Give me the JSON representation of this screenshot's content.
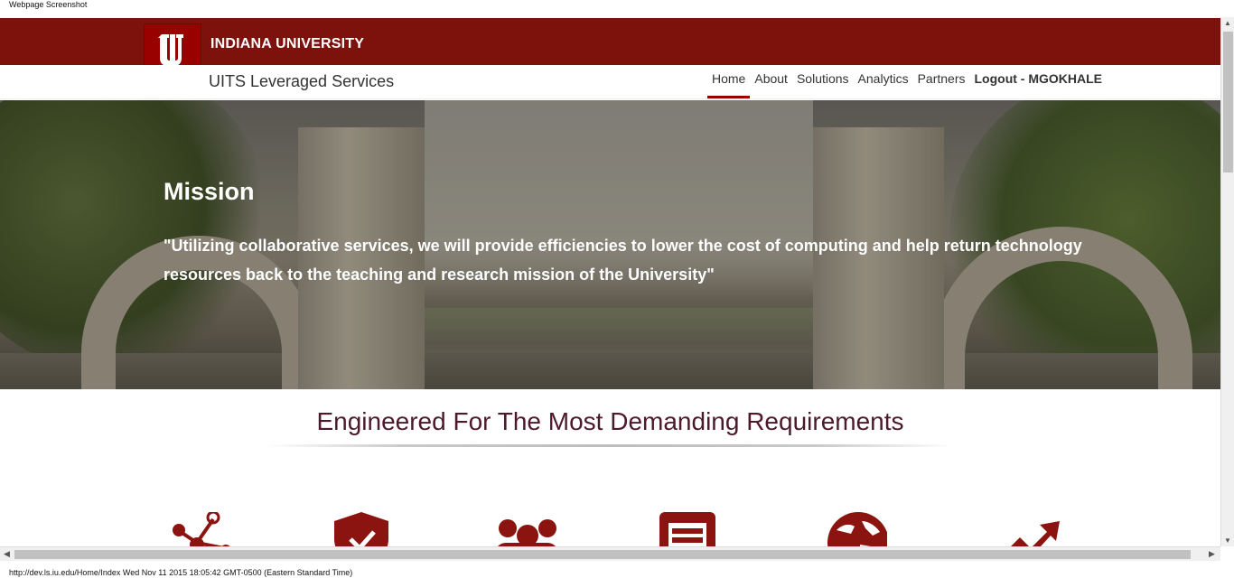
{
  "screenshot_label": "Webpage Screenshot",
  "header": {
    "university_name": "INDIANA UNIVERSITY",
    "site_title": "UITS Leveraged Services",
    "logo_icon": "iu-trident-logo",
    "brand_color": "#7d110c"
  },
  "nav": {
    "items": [
      {
        "label": "Home",
        "active": true
      },
      {
        "label": "About"
      },
      {
        "label": "Solutions"
      },
      {
        "label": "Analytics"
      },
      {
        "label": "Partners"
      },
      {
        "label": "Logout - MGOKHALE"
      }
    ]
  },
  "hero": {
    "title": "Mission",
    "quote": "\"Utilizing collaborative services, we will provide efficiencies to lower the cost of computing and help return technology resources back to the teaching and research mission of the University\""
  },
  "features": {
    "heading": "Engineered For The Most Demanding Requirements",
    "icons": [
      "network-icon",
      "shield-check-icon",
      "users-icon",
      "document-icon",
      "globe-icon",
      "trending-up-icon"
    ],
    "icon_color": "#8b1410"
  },
  "status_bar": {
    "text": "http://dev.ls.iu.edu/Home/Index Wed Nov 11 2015 18:05:42 GMT-0500 (Eastern Standard Time)"
  }
}
